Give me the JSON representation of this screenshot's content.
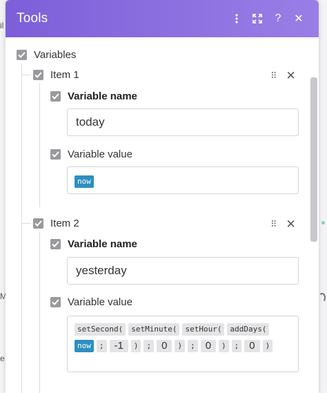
{
  "panel": {
    "title": "Tools",
    "header_icons": [
      "more-vertical-icon",
      "expand-icon",
      "help-icon",
      "close-icon"
    ],
    "help_label": "?",
    "close_label": "✕"
  },
  "root": {
    "label": "Variables"
  },
  "items": [
    {
      "label": "Item 1",
      "name_label": "Variable name",
      "name_value": "today",
      "value_label": "Variable value",
      "value_tokens": [
        "now"
      ]
    },
    {
      "label": "Item 2",
      "name_label": "Variable name",
      "name_value": "yesterday",
      "value_label": "Variable value",
      "tok": {
        "setSecond": "setSecond(",
        "setMinute": "setMinute(",
        "setHour": "setHour(",
        "addDays": "addDays(",
        "now": "now",
        "sep": ";",
        "minus1": "-1",
        "close": ")",
        "zero": "0"
      }
    }
  ],
  "background": {
    "frag1": "il",
    "frag2": "M",
    "frag3": "e"
  },
  "colors": {
    "header_start": "#7c5fd9",
    "header_end": "#9a7ee6",
    "token_blue": "#2f8fc0",
    "checkbox": "#9a9a9e"
  }
}
